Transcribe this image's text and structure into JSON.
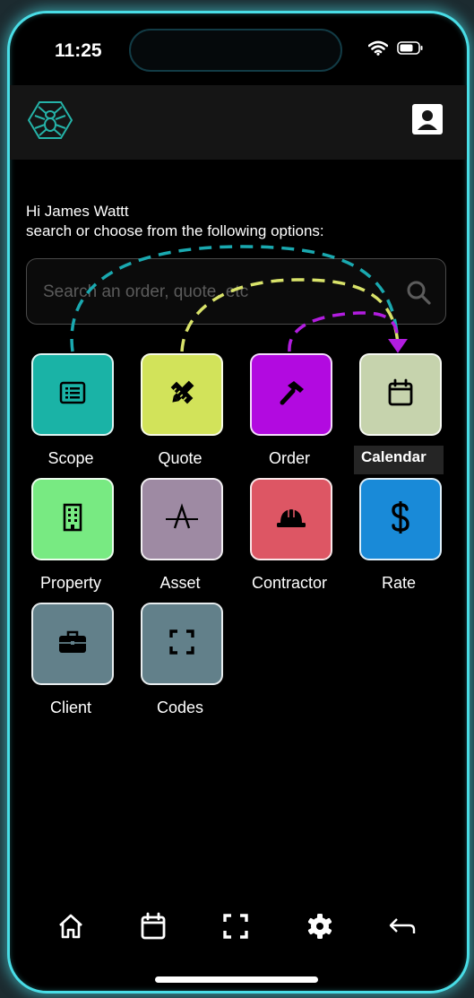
{
  "status_bar": {
    "time": "11:25"
  },
  "greeting": {
    "line1": "Hi James Wattt",
    "line2": "search or choose from the following options:"
  },
  "search": {
    "placeholder": "Search an order, quote, etc"
  },
  "tiles": [
    {
      "label": "Scope",
      "color": "#1ab3a6",
      "icon": "list-alt-icon"
    },
    {
      "label": "Quote",
      "color": "#d2e35a",
      "icon": "pencil-ruler-icon"
    },
    {
      "label": "Order",
      "color": "#b20ae0",
      "icon": "hammer-icon"
    },
    {
      "label": "Calendar",
      "color": "#c6d3ad",
      "icon": "calendar-icon"
    },
    {
      "label": "Property",
      "color": "#78ea82",
      "icon": "building-icon"
    },
    {
      "label": "Asset",
      "color": "#9e8aa3",
      "icon": "asset-icon"
    },
    {
      "label": "Contractor",
      "color": "#dd5664",
      "icon": "hard-hat-icon"
    },
    {
      "label": "Rate",
      "color": "#198ad8",
      "icon": "dollar-icon"
    },
    {
      "label": "Client",
      "color": "#62808a",
      "icon": "briefcase-icon"
    },
    {
      "label": "Codes",
      "color": "#62808a",
      "icon": "scan-icon"
    }
  ],
  "tooltip": {
    "text": "Calendar"
  },
  "arrow_colors": {
    "scope": "#1aa9b0",
    "quote": "#d9e36a",
    "order": "#b21de0"
  },
  "bottom_nav": [
    "home-icon",
    "calendar-icon",
    "scan-icon",
    "gear-icon",
    "back-arrow-icon"
  ]
}
